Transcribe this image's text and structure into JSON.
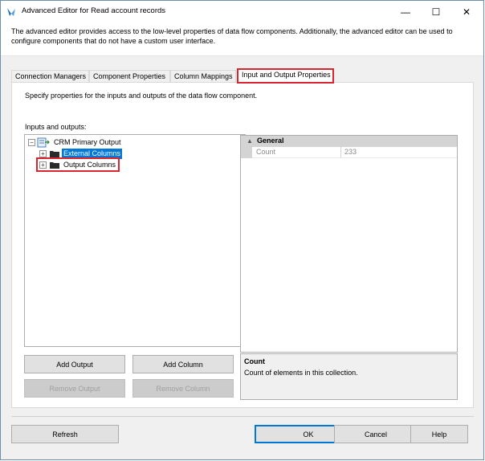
{
  "window": {
    "title": "Advanced Editor for Read account records",
    "minimize_glyph": "—",
    "maximize_glyph": "☐",
    "close_glyph": "✕"
  },
  "description": "The advanced editor provides access to the low-level properties of data flow components. Additionally, the advanced editor can be used to configure components that do not have a custom user interface.",
  "tabs": [
    {
      "label": "Connection Managers",
      "active": false
    },
    {
      "label": "Component Properties",
      "active": false
    },
    {
      "label": "Column Mappings",
      "active": false
    },
    {
      "label": "Input and Output Properties",
      "active": true
    }
  ],
  "panel": {
    "description": "Specify properties for the inputs and outputs of the data flow component.",
    "io_label": "Inputs and outputs:"
  },
  "tree": {
    "root": {
      "label": "CRM Primary Output",
      "expander": "−"
    },
    "children": [
      {
        "label": "External Columns",
        "expander": "+",
        "selected": true
      },
      {
        "label": "Output Columns",
        "expander": "+",
        "selected": false,
        "highlighted": true
      }
    ]
  },
  "buttons": {
    "add_output": "Add Output",
    "add_column": "Add Column",
    "remove_output": "Remove Output",
    "remove_column": "Remove Column"
  },
  "property_grid": {
    "category": "General",
    "category_glyph": "▲",
    "rows": [
      {
        "name": "Count",
        "value": "233"
      }
    ]
  },
  "help": {
    "title": "Count",
    "text": "Count of elements in this collection."
  },
  "footer": {
    "refresh": "Refresh",
    "ok": "OK",
    "cancel": "Cancel",
    "help": "Help"
  },
  "colors": {
    "highlight_red": "#d9262e",
    "selection_blue": "#0078d7"
  }
}
